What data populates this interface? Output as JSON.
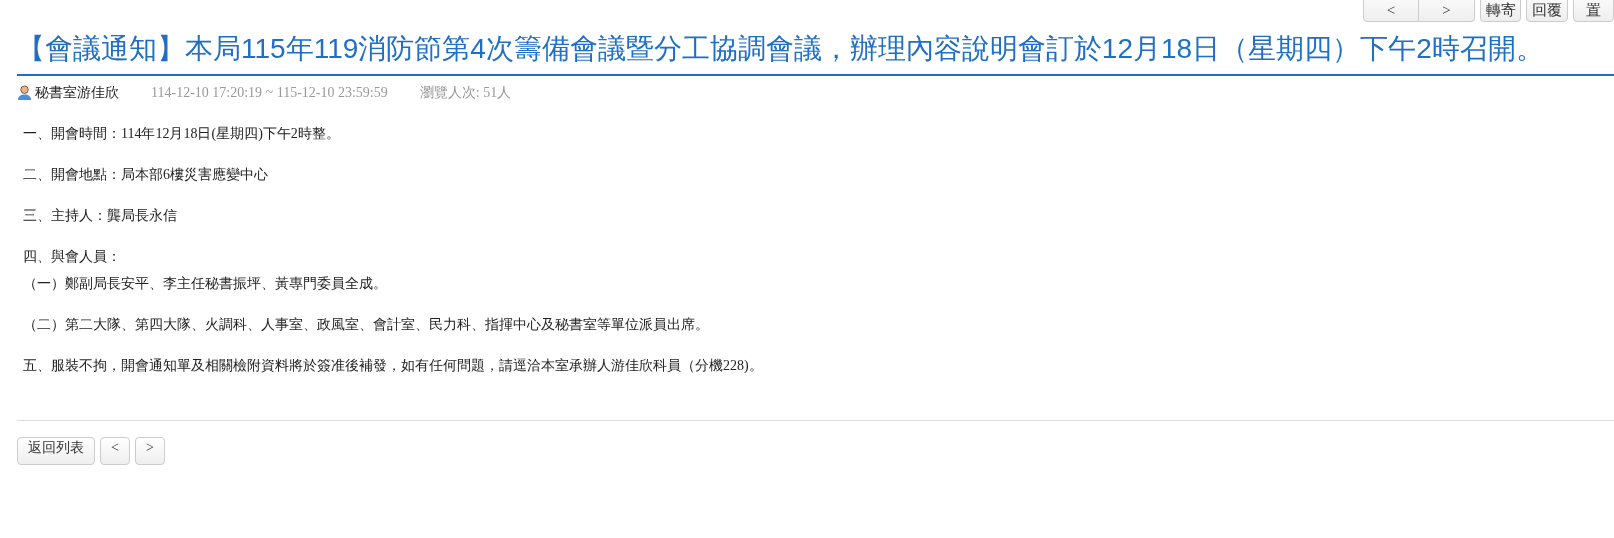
{
  "toolbar": {
    "nav_buttons": [
      "<",
      ">"
    ],
    "buttons": [
      "轉寄",
      "回覆",
      "置"
    ]
  },
  "title": "【會議通知】本局115年119消防節第4次籌備會議暨分工協調會議，辦理內容說明會訂於12月18日（星期四）下午2時召開。",
  "meta": {
    "author": "秘書室游佳欣",
    "period": "114-12-10 17:20:19 ~ 115-12-10 23:59:59",
    "views": "瀏覽人次: 51人"
  },
  "content": [
    {
      "kind": "item",
      "text": "一、開會時間：114年12月18日(星期四)下午2時整。"
    },
    {
      "kind": "item",
      "text": "二、開會地點：局本部6樓災害應變中心"
    },
    {
      "kind": "item",
      "text": "三、主持人：龔局長永信"
    },
    {
      "kind": "heading",
      "text": "四、與會人員："
    },
    {
      "kind": "item",
      "text": "（一）鄭副局長安平、李主任秘書振坪、黃專門委員全成。"
    },
    {
      "kind": "item",
      "text": "（二）第二大隊、第四大隊、火調科、人事室、政風室、會計室、民力科、指揮中心及秘書室等單位派員出席。"
    },
    {
      "kind": "item",
      "text": "五、服裝不拘，開會通知單及相關檢附資料將於簽准後補發，如有任何問題，請逕洽本室承辦人游佳欣科員（分機228)。"
    }
  ],
  "footer": {
    "back_button": "返回列表",
    "prev_button": "<",
    "next_button": ">"
  }
}
